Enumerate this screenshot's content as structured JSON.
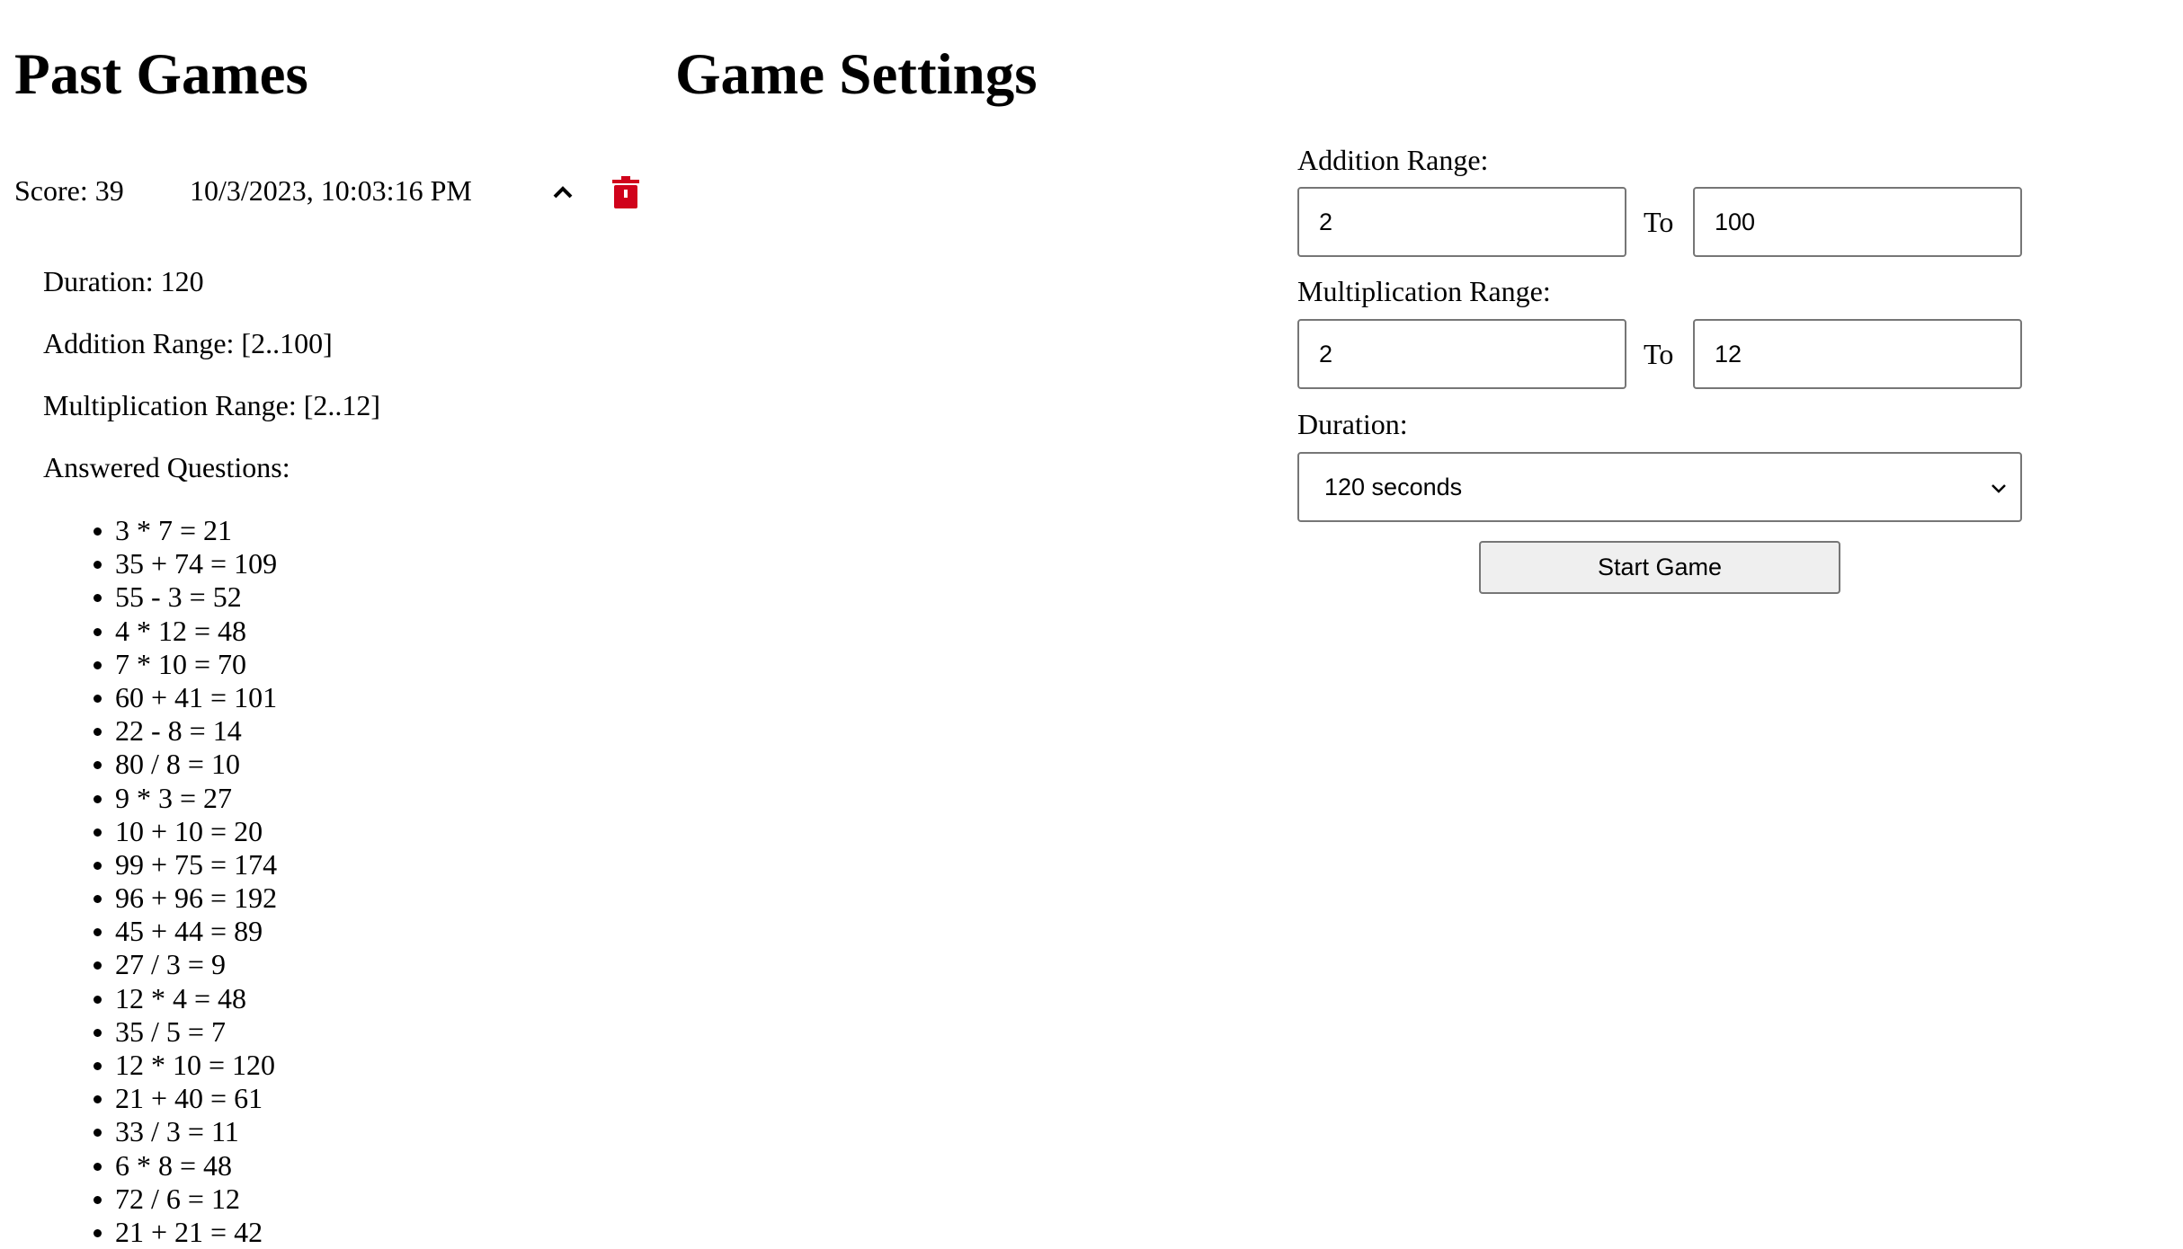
{
  "past_games": {
    "title": "Past Games",
    "game": {
      "score": "Score: 39",
      "date": "10/3/2023, 10:03:16 PM",
      "duration": "Duration: 120",
      "addition_range": "Addition Range: [2..100]",
      "multiplication_range": "Multiplication Range: [2..12]",
      "answered_label": "Answered Questions:",
      "questions": [
        "3 * 7 = 21",
        "35 + 74 = 109",
        "55 - 3 = 52",
        "4 * 12 = 48",
        "7 * 10 = 70",
        "60 + 41 = 101",
        "22 - 8 = 14",
        "80 / 8 = 10",
        "9 * 3 = 27",
        "10 + 10 = 20",
        "99 + 75 = 174",
        "96 + 96 = 192",
        "45 + 44 = 89",
        "27 / 3 = 9",
        "12 * 4 = 48",
        "35 / 5 = 7",
        "12 * 10 = 120",
        "21 + 40 = 61",
        "33 / 3 = 11",
        "6 * 8 = 48",
        "72 / 6 = 12",
        "21 + 21 = 42"
      ]
    },
    "icons": {
      "collapse": "chevron-up-icon",
      "delete": "trash-icon",
      "delete_color": "#d0021b"
    }
  },
  "settings": {
    "title": "Game Settings",
    "addition_label": "Addition Range:",
    "addition_from": "2",
    "addition_to": "100",
    "multiplication_label": "Multiplication Range:",
    "multiplication_from": "2",
    "multiplication_to": "12",
    "to_label": "To",
    "duration_label": "Duration:",
    "duration_value": "120 seconds",
    "start_label": "Start Game"
  }
}
